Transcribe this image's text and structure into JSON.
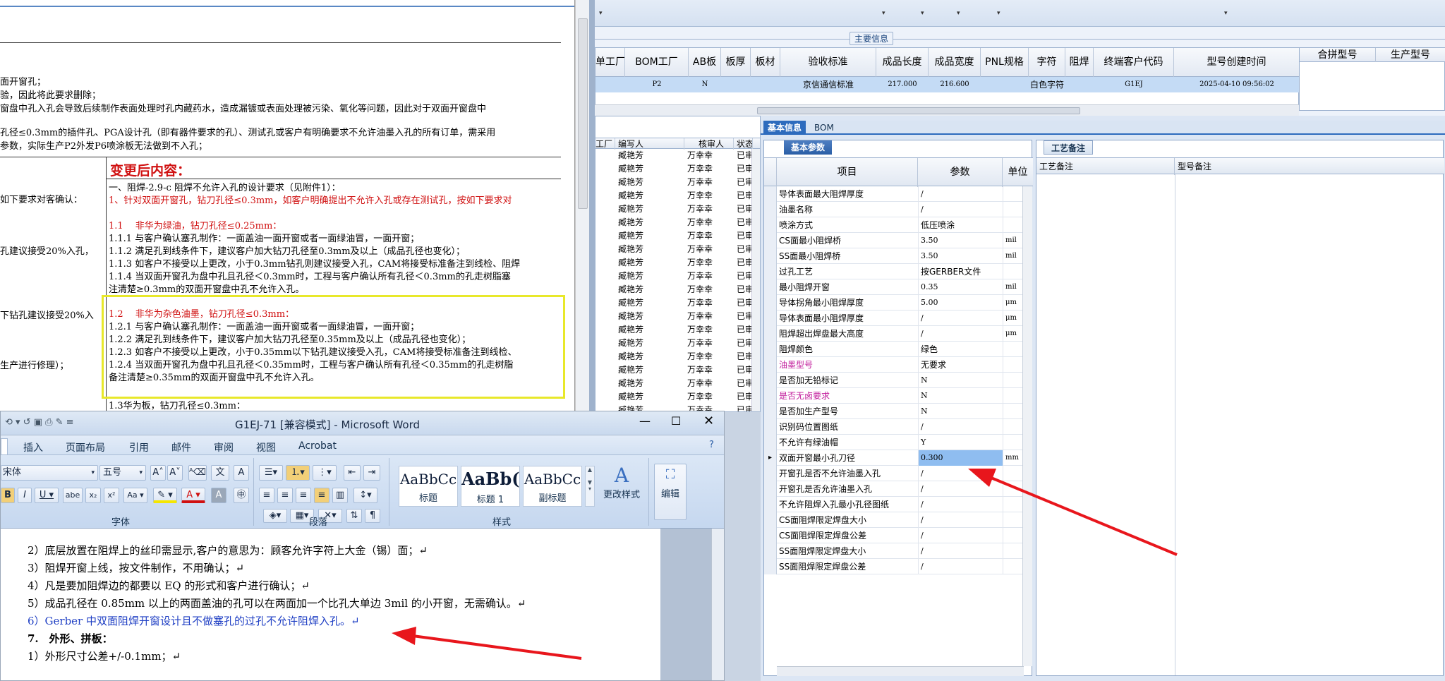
{
  "doc1": {
    "lines_top": [
      "面开窗孔；",
      "验，因此将此要求删除；",
      "窗盘中孔入孔会导致后续制作表面处理时孔内藏药水，造成漏镀或表面处理被污染、氧化等问题，因此对于双面开窗盘中",
      "孔径≤0.3mm的插件孔、PGA设计孔（即有器件要求的孔）、测试孔或客户有明确要求不允许油墨入孔的所有订单，需采用",
      "参数，实际生产P2外发P6喷涂板无法做到不入孔；"
    ],
    "change_title": "变更后内容：",
    "left_notes": [
      "如下要求对客确认：",
      "孔建议接受20%入孔，",
      "下钻孔建议接受20%入",
      "生产进行修理）；"
    ],
    "right_lines": [
      "一、阻焊-2.9-c 阻焊不允许入孔的设计要求（见附件1）：",
      "1、针对双面开窗孔，钻刀孔径≤0.3mm，如客户明确提出不允许入孔或存在测试孔，按如下要求对",
      "1.1　 非华为绿油，钻刀孔径≤0.25mm：",
      "1.1.1 与客户确认塞孔制作：一面盖油一面开窗或者一面绿油冒，一面开窗；",
      "1.1.2 满足孔到线条件下，建议客户加大钻刀孔径至0.3mm及以上（成品孔径也变化）；",
      "1.1.3 如客户不接受以上更改，小于0.3mm钻孔则建议接受入孔，CAM将接受标准备注到线检、阻焊",
      "1.1.4 当双面开窗孔为盘中孔且孔径＜0.3mm时，工程与客户确认所有孔径＜0.3mm的孔走树脂塞",
      "注清楚≥0.3mm的双面开窗盘中孔不允许入孔。"
    ],
    "box_lines": [
      "1.2　 非华为杂色油墨，钻刀孔径≤0.3mm：",
      "1.2.1 与客户确认塞孔制作：一面盖油一面开窗或者一面绿油冒，一面开窗；",
      "1.2.2 满足孔到线条件下，建议客户加大钻刀孔径至0.35mm及以上（成品孔径也变化）；",
      "1.2.3 如客户不接受以上更改，小于0.35mm以下钻孔建议接受入孔，CAM将接受标准备注到线检、",
      "1.2.4 当双面开窗孔为盘中孔且孔径＜0.35mm时，工程与客户确认所有孔径＜0.35mm的孔走树脂",
      "备注清楚≥0.35mm的双面开窗盘中孔不允许入孔。"
    ],
    "bottom_line": "1.3华为板，钻刀孔径≤0.3mm："
  },
  "main_info": {
    "title": "主要信息",
    "columns": [
      "单工厂",
      "BOM工厂",
      "AB板",
      "板厚",
      "板材",
      "验收标准",
      "成品长度",
      "成品宽度",
      "PNL规格",
      "字符",
      "阻焊",
      "终端客户代码",
      "型号创建时间"
    ],
    "row": [
      "",
      "P2",
      "N",
      "",
      "",
      "京信通信标准",
      "217.000",
      "216.600",
      "",
      "白色字符",
      "",
      "G1EJ",
      "2025-04-10 09:56:02"
    ],
    "combo_columns": [
      "合拼型号",
      "生产型号"
    ]
  },
  "list": {
    "columns": [
      "工厂",
      "编写人",
      "核审人",
      "状态"
    ],
    "row_writer": "臧艳芳",
    "row_reviewer": "万幸幸",
    "row_status": "已审核",
    "row_count": 23
  },
  "word": {
    "title": "G1EJ-71 [兼容模式] - Microsoft Word",
    "menu": [
      "插入",
      "页面布局",
      "引用",
      "邮件",
      "审阅",
      "视图",
      "Acrobat"
    ],
    "font_name": "宋体",
    "font_size": "五号",
    "styles": [
      {
        "sample": "AaBbCc",
        "label": "标题"
      },
      {
        "sample": "AaBb(",
        "label": "标题 1"
      },
      {
        "sample": "AaBbCc",
        "label": "副标题"
      }
    ],
    "change_style": "更改样式",
    "edit": "编辑",
    "groups": [
      "字体",
      "段落",
      "样式"
    ],
    "lines": [
      "2）底层放置在阻焊上的丝印需显示,客户的意思为：顾客允许字符上大金（锡）面；↵",
      "3）阻焊开窗上线，按文件制作，不用确认；↵",
      "4）凡是要加阻焊边的都要以 EQ 的形式和客户进行确认；↵",
      "5）成品孔径在 0.85mm 以上的两面盖油的孔可以在两面加一个比孔大单边 3mil 的小开窗，无需确认。↵",
      "6）Gerber 中双面阻焊开窗设计且不做塞孔的过孔不允许阻焊入孔。↵",
      "7.　外形、拼板：",
      "1）外形尺寸公差+/-0.1mm；↵"
    ]
  },
  "tabs": {
    "basic_info": "基本信息",
    "bom": "BOM",
    "basic_params": "基本参数",
    "craft_notes": "工艺备注"
  },
  "params": {
    "headers": [
      "项目",
      "参数",
      "单位"
    ],
    "rows": [
      {
        "item": "导体表面最大阻焊厚度",
        "value": "/",
        "unit": ""
      },
      {
        "item": "油墨名称",
        "value": "/",
        "unit": ""
      },
      {
        "item": "喷涂方式",
        "value": "低压喷涂",
        "unit": ""
      },
      {
        "item": "CS面最小阻焊桥",
        "value": "3.50",
        "unit": "mil"
      },
      {
        "item": "SS面最小阻焊桥",
        "value": "3.50",
        "unit": "mil"
      },
      {
        "item": "过孔工艺",
        "value": "按GERBER文件",
        "unit": ""
      },
      {
        "item": "最小阻焊开窗",
        "value": "0.35",
        "unit": "mil"
      },
      {
        "item": "导体拐角最小阻焊厚度",
        "value": "5.00",
        "unit": "μm"
      },
      {
        "item": "导体表面最小阻焊厚度",
        "value": "/",
        "unit": "μm"
      },
      {
        "item": "阻焊超出焊盘最大高度",
        "value": "/",
        "unit": "μm"
      },
      {
        "item": "阻焊颜色",
        "value": "绿色",
        "unit": ""
      },
      {
        "item": "油墨型号",
        "value": "无要求",
        "unit": ""
      },
      {
        "item": "是否加无铅标记",
        "value": "N",
        "unit": ""
      },
      {
        "item": "是否无卤要求",
        "value": "N",
        "unit": ""
      },
      {
        "item": "是否加生产型号",
        "value": "N",
        "unit": ""
      },
      {
        "item": "识别码位置图纸",
        "value": "/",
        "unit": ""
      },
      {
        "item": "不允许有绿油帽",
        "value": "Y",
        "unit": ""
      },
      {
        "item": "双面开窗最小孔刀径",
        "value": "0.300",
        "unit": "mm"
      },
      {
        "item": "开窗孔是否不允许油墨入孔",
        "value": "/",
        "unit": ""
      },
      {
        "item": "开窗孔是否允许油墨入孔",
        "value": "/",
        "unit": ""
      },
      {
        "item": "不允许阻焊入孔最小孔径图纸",
        "value": "/",
        "unit": ""
      },
      {
        "item": "CS面阻焊限定焊盘大小",
        "value": "/",
        "unit": ""
      },
      {
        "item": "CS面阻焊限定焊盘公差",
        "value": "/",
        "unit": ""
      },
      {
        "item": "SS面阻焊限定焊盘大小",
        "value": "/",
        "unit": ""
      },
      {
        "item": "SS面阻焊限定焊盘公差",
        "value": "/",
        "unit": ""
      }
    ]
  },
  "craft": {
    "col1": "工艺备注",
    "col2": "型号备注"
  },
  "colors": {
    "accent_red": "#d01010",
    "highlight_box": "#e8e82a",
    "arrow": "#e8161c",
    "selected_row": "#c4dbf5",
    "magenta": "#c0189a"
  }
}
